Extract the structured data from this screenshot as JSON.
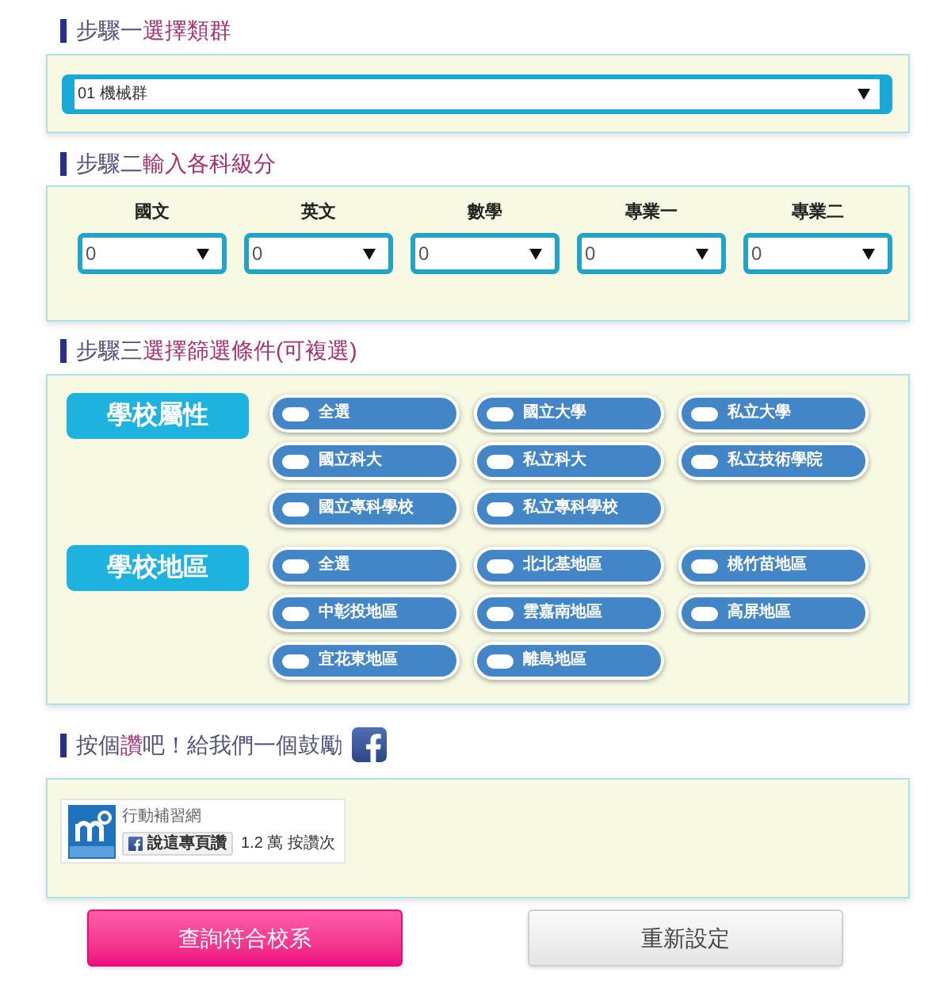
{
  "step1": {
    "heading": [
      {
        "text": "步驟一",
        "highlight": false
      },
      {
        "text": "選擇類群",
        "highlight": true
      }
    ],
    "group_select": {
      "value": "01 機械群"
    }
  },
  "step2": {
    "heading": [
      {
        "text": "步驟二",
        "highlight": false
      },
      {
        "text": "輸入各科級分",
        "highlight": true
      }
    ],
    "scores": [
      {
        "label": "國文",
        "value": "0"
      },
      {
        "label": "英文",
        "value": "0"
      },
      {
        "label": "數學",
        "value": "0"
      },
      {
        "label": "專業一",
        "value": "0"
      },
      {
        "label": "專業二",
        "value": "0"
      }
    ]
  },
  "step3": {
    "heading": [
      {
        "text": "步驟三",
        "highlight": false
      },
      {
        "text": "選擇篩選條件(可複選)",
        "highlight": true
      }
    ],
    "filter_groups": [
      {
        "label": "學校屬性",
        "options": [
          {
            "label": "全選",
            "checked": false
          },
          {
            "label": "國立大學",
            "checked": false
          },
          {
            "label": "私立大學",
            "checked": false
          },
          {
            "label": "國立科大",
            "checked": false
          },
          {
            "label": "私立科大",
            "checked": false
          },
          {
            "label": "私立技術學院",
            "checked": false
          },
          {
            "label": "國立專科學校",
            "checked": false
          },
          {
            "label": "私立專科學校",
            "checked": false
          }
        ]
      },
      {
        "label": "學校地區",
        "options": [
          {
            "label": "全選",
            "checked": false
          },
          {
            "label": "北北基地區",
            "checked": false
          },
          {
            "label": "桃竹苗地區",
            "checked": false
          },
          {
            "label": "中彰投地區",
            "checked": false
          },
          {
            "label": "雲嘉南地區",
            "checked": false
          },
          {
            "label": "高屏地區",
            "checked": false
          },
          {
            "label": "宜花東地區",
            "checked": false
          },
          {
            "label": "離島地區",
            "checked": false
          }
        ]
      }
    ]
  },
  "like_section": {
    "heading": [
      {
        "text": "按個",
        "highlight": false
      },
      {
        "text": "讚",
        "highlight": true
      },
      {
        "text": "吧！給我們一個鼓勵",
        "highlight": false
      }
    ],
    "widget": {
      "page_name": "行動補習網",
      "like_button": "說這專頁讚",
      "like_count": "1.2 萬 按讚次"
    }
  },
  "buttons": [
    {
      "label": "查詢符合校系",
      "kind": "primary"
    },
    {
      "label": "重新設定",
      "kind": "secondary"
    }
  ]
}
